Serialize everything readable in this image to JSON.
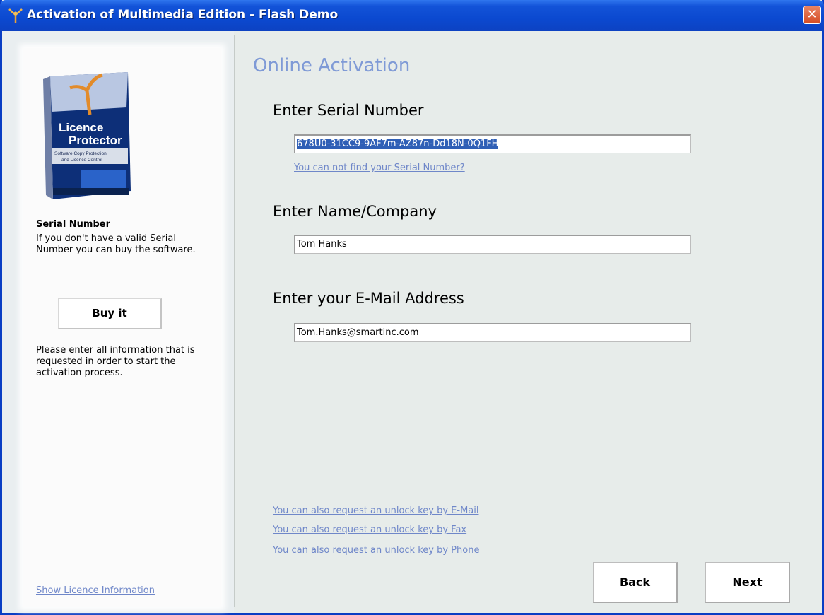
{
  "window": {
    "title": "Activation of Multimedia Edition - Flash Demo",
    "close_symbol": "✕",
    "icons": [
      "app-logo-icon",
      "close-icon"
    ]
  },
  "sidebar": {
    "product_image": "Licence Protector box",
    "product_box_text": [
      "Licence",
      "Protector",
      "Software Copy Protection",
      "and Licence Control"
    ],
    "heading": "Serial Number",
    "text1": "If you don't have a valid Serial Number you can buy the software.",
    "buy_label": "Buy it",
    "text2": "Please enter all information that is requested in order to start the activation process.",
    "show_licence_link": "Show Licence Information"
  },
  "main": {
    "title": "Online Activation",
    "serial": {
      "label": "Enter Serial Number",
      "value": "678U0-31CC9-9AF7m-AZ87n-Dd18N-0Q1FH",
      "help_link": "You can not find your Serial Number?"
    },
    "name": {
      "label": "Enter Name/Company",
      "value": "Tom Hanks"
    },
    "email": {
      "label": "Enter your E-Mail Address",
      "value": "Tom.Hanks@smartinc.com"
    },
    "request_links": [
      "You can also request an unlock key by E-Mail",
      "You can also request an unlock key by Fax",
      "You can also request an unlock key by Phone"
    ]
  },
  "buttons": {
    "back": "Back",
    "next": "Next"
  },
  "colors": {
    "titlebar": "#0b49d0",
    "link": "#6f87c9",
    "heading_accent": "#7f9ad6",
    "selection": "#2f5fb6",
    "close_button": "#d54c23"
  }
}
